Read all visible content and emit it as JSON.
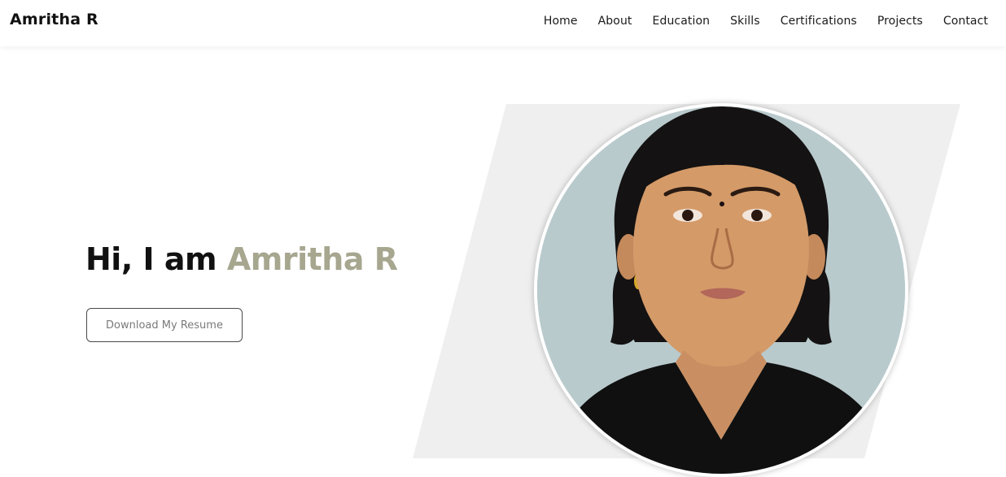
{
  "navbar": {
    "brand": "Amritha R",
    "links": [
      {
        "label": "Home"
      },
      {
        "label": "About"
      },
      {
        "label": "Education"
      },
      {
        "label": "Skills"
      },
      {
        "label": "Certifications"
      },
      {
        "label": "Projects"
      },
      {
        "label": "Contact"
      }
    ]
  },
  "hero": {
    "greeting": "Hi, I am ",
    "name": "Amritha R",
    "button_label": "Download My Resume"
  },
  "colors": {
    "accent": "#a7a68f",
    "text": "#111111",
    "panel": "#efefef",
    "photo_background": "#b9cacd"
  }
}
